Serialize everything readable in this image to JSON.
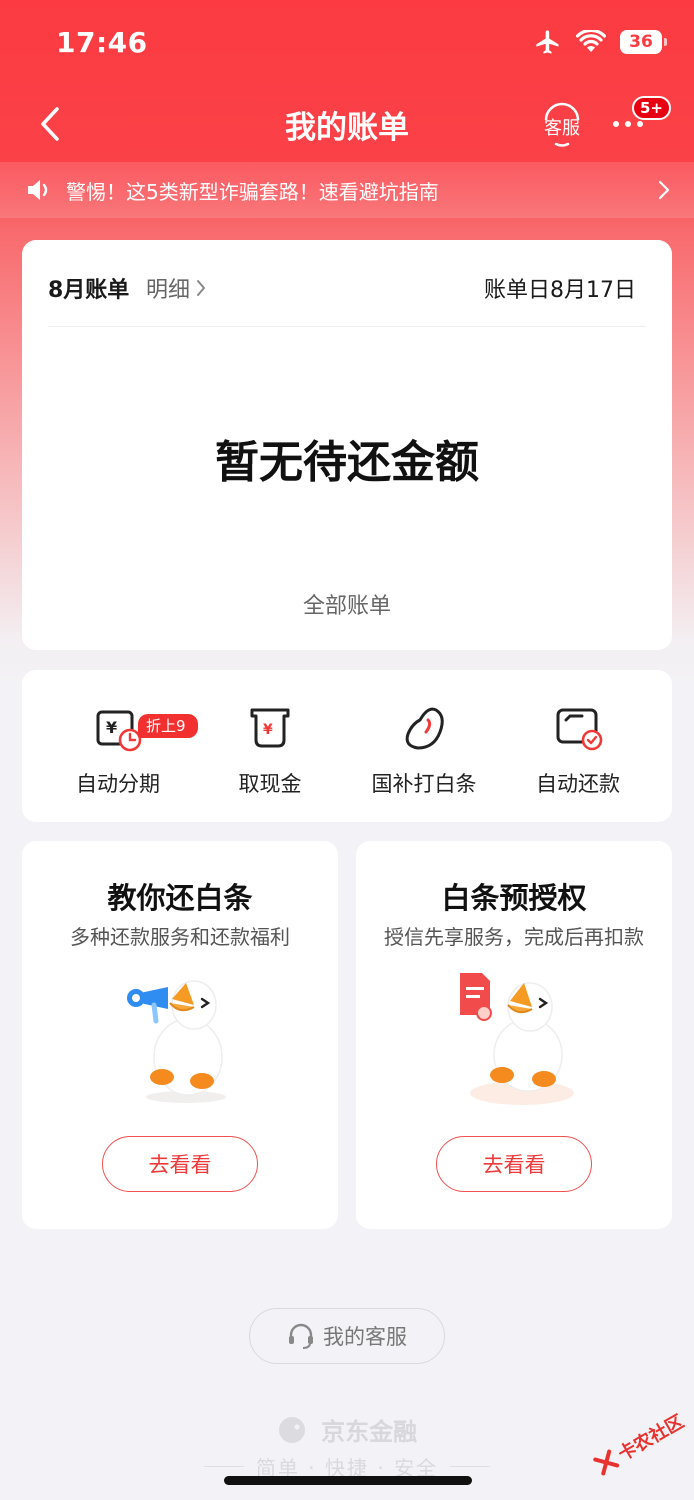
{
  "status_bar": {
    "time": "17:46",
    "battery": "36"
  },
  "nav": {
    "title": "我的账单",
    "service_label": "客服",
    "more_badge": "5+"
  },
  "notice": {
    "text": "警惕！这5类新型诈骗套路！速看避坑指南"
  },
  "bill": {
    "month_label": "8月账单",
    "detail_label": "明细",
    "bill_date": "账单日8月17日",
    "amount_text": "暂无待还金额",
    "all_bills": "全部账单"
  },
  "shortcuts": [
    {
      "label": "自动分期",
      "icon": "auto-installment-icon",
      "badge": "折上9折"
    },
    {
      "label": "取现金",
      "icon": "cash-withdraw-icon"
    },
    {
      "label": "国补打白条",
      "icon": "bean-icon"
    },
    {
      "label": "自动还款",
      "icon": "auto-repay-icon"
    }
  ],
  "promos": [
    {
      "title": "教你还白条",
      "subtitle": "多种还款服务和还款福利",
      "button": "去看看"
    },
    {
      "title": "白条预授权",
      "subtitle": "授信先享服务，完成后再扣款",
      "button": "去看看"
    }
  ],
  "footer": {
    "customer_service": "我的客服",
    "brand": "京东金融",
    "tagline": "简单 · 快捷 · 安全",
    "watermark": "卡农社区"
  },
  "colors": {
    "accent": "#fb3b41",
    "button_text": "#ee3a3a",
    "badge": "#f23030"
  }
}
